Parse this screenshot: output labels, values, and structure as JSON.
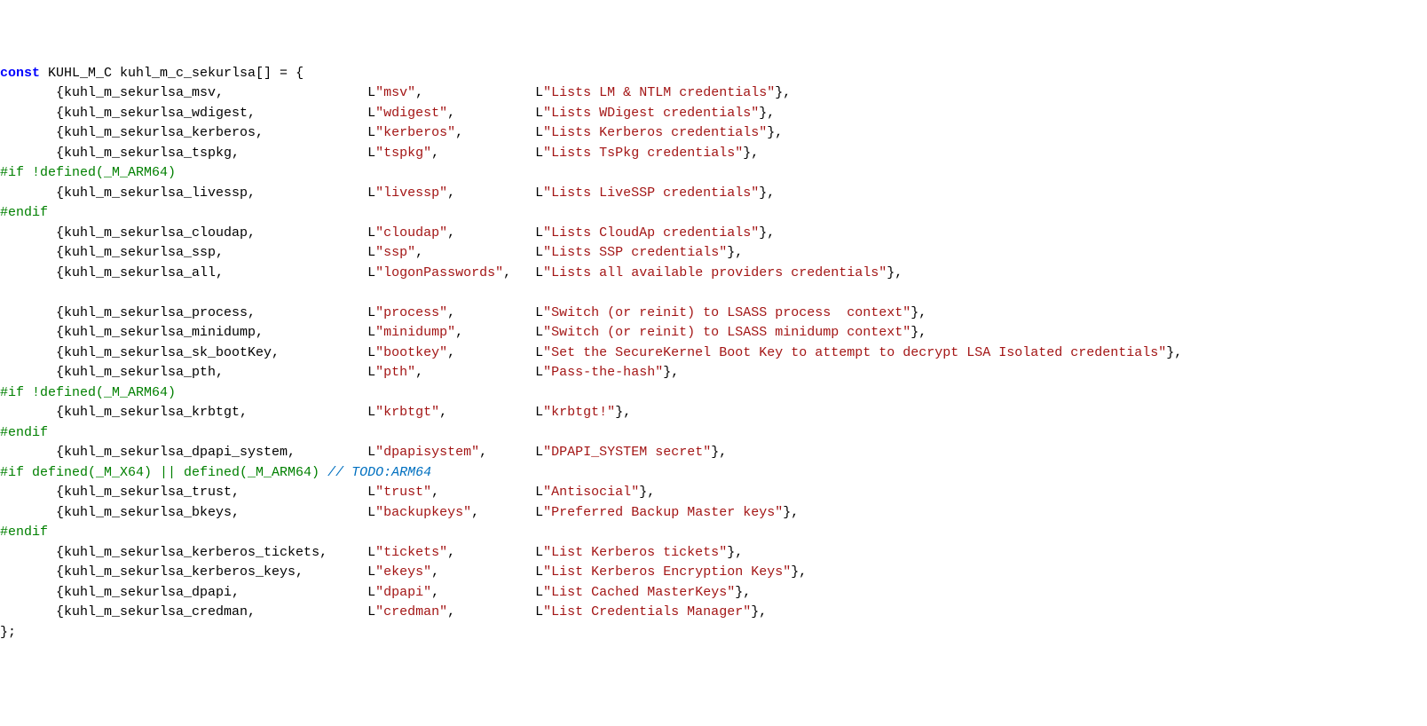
{
  "keyword_const": "const",
  "type_name": " KUHL_M_C kuhl_m_c_sekurlsa[] = {",
  "indent": "       ",
  "col1_width": 39,
  "col2_width": 21,
  "entries": [
    {
      "fn": "kuhl_m_sekurlsa_msv",
      "name": "msv",
      "desc": "Lists LM & NTLM credentials"
    },
    {
      "fn": "kuhl_m_sekurlsa_wdigest",
      "name": "wdigest",
      "desc": "Lists WDigest credentials"
    },
    {
      "fn": "kuhl_m_sekurlsa_kerberos",
      "name": "kerberos",
      "desc": "Lists Kerberos credentials"
    },
    {
      "fn": "kuhl_m_sekurlsa_tspkg",
      "name": "tspkg",
      "desc": "Lists TsPkg credentials"
    },
    {
      "pp": "#if !defined(_M_ARM64)"
    },
    {
      "fn": "kuhl_m_sekurlsa_livessp",
      "name": "livessp",
      "desc": "Lists LiveSSP credentials"
    },
    {
      "pp": "#endif"
    },
    {
      "fn": "kuhl_m_sekurlsa_cloudap",
      "name": "cloudap",
      "desc": "Lists CloudAp credentials"
    },
    {
      "fn": "kuhl_m_sekurlsa_ssp",
      "name": "ssp",
      "desc": "Lists SSP credentials"
    },
    {
      "fn": "kuhl_m_sekurlsa_all",
      "name": "logonPasswords",
      "desc": "Lists all available providers credentials"
    },
    {
      "blank": true
    },
    {
      "fn": "kuhl_m_sekurlsa_process",
      "name": "process",
      "desc": "Switch (or reinit) to LSASS process  context"
    },
    {
      "fn": "kuhl_m_sekurlsa_minidump",
      "name": "minidump",
      "desc": "Switch (or reinit) to LSASS minidump context"
    },
    {
      "fn": "kuhl_m_sekurlsa_sk_bootKey",
      "name": "bootkey",
      "desc": "Set the SecureKernel Boot Key to attempt to decrypt LSA Isolated credentials"
    },
    {
      "fn": "kuhl_m_sekurlsa_pth",
      "name": "pth",
      "desc": "Pass-the-hash"
    },
    {
      "pp": "#if !defined(_M_ARM64)"
    },
    {
      "fn": "kuhl_m_sekurlsa_krbtgt",
      "name": "krbtgt",
      "desc": "krbtgt!"
    },
    {
      "pp": "#endif"
    },
    {
      "fn": "kuhl_m_sekurlsa_dpapi_system",
      "name": "dpapisystem",
      "desc": "DPAPI_SYSTEM secret"
    },
    {
      "pp": "#if defined(_M_X64) || defined(_M_ARM64)",
      "comment": " // TODO:ARM64"
    },
    {
      "fn": "kuhl_m_sekurlsa_trust",
      "name": "trust",
      "desc": "Antisocial"
    },
    {
      "fn": "kuhl_m_sekurlsa_bkeys",
      "name": "backupkeys",
      "desc": "Preferred Backup Master keys"
    },
    {
      "pp": "#endif"
    },
    {
      "fn": "kuhl_m_sekurlsa_kerberos_tickets",
      "name": "tickets",
      "desc": "List Kerberos tickets"
    },
    {
      "fn": "kuhl_m_sekurlsa_kerberos_keys",
      "name": "ekeys",
      "desc": "List Kerberos Encryption Keys"
    },
    {
      "fn": "kuhl_m_sekurlsa_dpapi",
      "name": "dpapi",
      "desc": "List Cached MasterKeys"
    },
    {
      "fn": "kuhl_m_sekurlsa_credman",
      "name": "credman",
      "desc": "List Credentials Manager"
    }
  ],
  "closer": "};"
}
